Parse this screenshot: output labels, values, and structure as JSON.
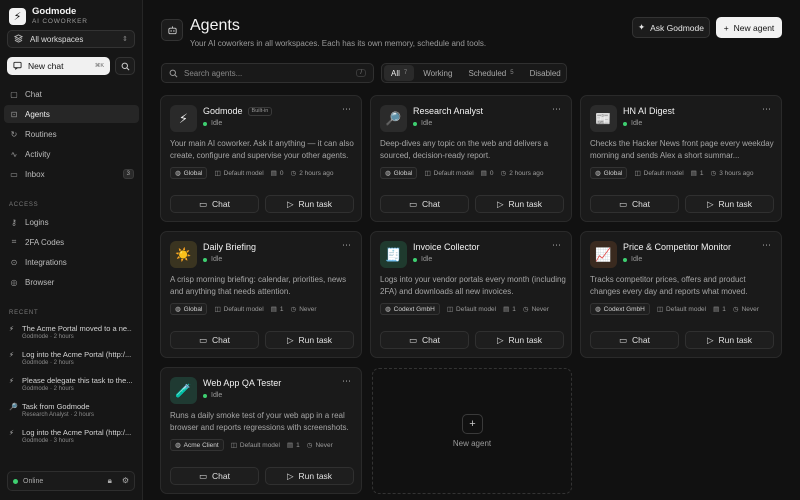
{
  "brand": {
    "name": "Godmode",
    "sub": "AI COWORKER"
  },
  "workspace": {
    "label": "All workspaces"
  },
  "new_chat": {
    "label": "New chat",
    "shortcut": "⌘K"
  },
  "nav": [
    {
      "label": "Chat",
      "icon": "chat-icon"
    },
    {
      "label": "Agents",
      "icon": "bot-icon"
    },
    {
      "label": "Routines",
      "icon": "routines-icon"
    },
    {
      "label": "Activity",
      "icon": "activity-icon"
    },
    {
      "label": "Inbox",
      "icon": "inbox-icon",
      "badge": "3"
    }
  ],
  "access": {
    "label": "ACCESS",
    "items": [
      {
        "label": "Logins",
        "icon": "key-icon"
      },
      {
        "label": "2FA Codes",
        "icon": "code-icon"
      },
      {
        "label": "Integrations",
        "icon": "integrations-icon"
      },
      {
        "label": "Browser",
        "icon": "globe-icon"
      }
    ]
  },
  "recent": {
    "label": "RECENT",
    "items": [
      {
        "title": "The Acme Portal moved to a ne...",
        "meta": "Godmode · 2 hours"
      },
      {
        "title": "Log into the Acme Portal (http:/...",
        "meta": "Godmode · 2 hours"
      },
      {
        "title": "Please delegate this task to the...",
        "meta": "Godmode · 2 hours"
      },
      {
        "title": "Task from Godmode",
        "meta": "Research Analyst · 2 hours"
      },
      {
        "title": "Log into the Acme Portal (http:/...",
        "meta": "Godmode · 3 hours"
      }
    ]
  },
  "footer": {
    "status": "Online"
  },
  "header": {
    "title": "Agents",
    "subtitle": "Your AI coworkers in all workspaces. Each has its own memory, schedule and tools.",
    "ask_label": "Ask Godmode",
    "new_agent_label": "New agent"
  },
  "search": {
    "placeholder": "Search agents...",
    "shortcut": "/"
  },
  "tabs": [
    {
      "label": "All",
      "count": "7"
    },
    {
      "label": "Working",
      "count": ""
    },
    {
      "label": "Scheduled",
      "count": "5"
    },
    {
      "label": "Disabled",
      "count": ""
    }
  ],
  "agents": [
    {
      "name": "Godmode",
      "badge": "Built-in",
      "status": "Idle",
      "icon": "⚡",
      "icon_bg": "#2a2a2a",
      "desc": "Your main AI coworker. Ask it anything — it can also create, configure and supervise your other agents.",
      "workspace": "Global",
      "model": "Default model",
      "tasks": "0",
      "last": "2 hours ago"
    },
    {
      "name": "Research Analyst",
      "badge": "",
      "status": "Idle",
      "icon": "🔎",
      "icon_bg": "#2b2b2b",
      "desc": "Deep-dives any topic on the web and delivers a sourced, decision-ready report.",
      "workspace": "Global",
      "model": "Default model",
      "tasks": "0",
      "last": "2 hours ago"
    },
    {
      "name": "HN AI Digest",
      "badge": "",
      "status": "Idle",
      "icon": "📰",
      "icon_bg": "#2b2b2b",
      "desc": "Checks the Hacker News front page every weekday morning and sends Alex a short summar...",
      "workspace": "Global",
      "model": "Default model",
      "tasks": "1",
      "last": "3 hours ago"
    },
    {
      "name": "Daily Briefing",
      "badge": "",
      "status": "Idle",
      "icon": "☀️",
      "icon_bg": "#3a3420",
      "desc": "A crisp morning briefing: calendar, priorities, news and anything that needs attention.",
      "workspace": "Global",
      "model": "Default model",
      "tasks": "1",
      "last": "Never"
    },
    {
      "name": "Invoice Collector",
      "badge": "",
      "status": "Idle",
      "icon": "🧾",
      "icon_bg": "#1f3a2e",
      "desc": "Logs into your vendor portals every month (including 2FA) and downloads all new invoices.",
      "workspace": "Codext GmbH",
      "model": "Default model",
      "tasks": "1",
      "last": "Never"
    },
    {
      "name": "Price & Competitor Monitor",
      "badge": "",
      "status": "Idle",
      "icon": "📈",
      "icon_bg": "#3a2a1f",
      "desc": "Tracks competitor prices, offers and product changes every day and reports what moved.",
      "workspace": "Codext GmbH",
      "model": "Default model",
      "tasks": "1",
      "last": "Never"
    },
    {
      "name": "Web App QA Tester",
      "badge": "",
      "status": "Idle",
      "icon": "🧪",
      "icon_bg": "#1f3a32",
      "desc": "Runs a daily smoke test of your web app in a real browser and reports regressions with screenshots.",
      "workspace": "Acme Client",
      "model": "Default model",
      "tasks": "1",
      "last": "Never"
    }
  ],
  "card_actions": {
    "chat": "Chat",
    "run": "Run task"
  },
  "new_agent_card": {
    "label": "New agent"
  }
}
